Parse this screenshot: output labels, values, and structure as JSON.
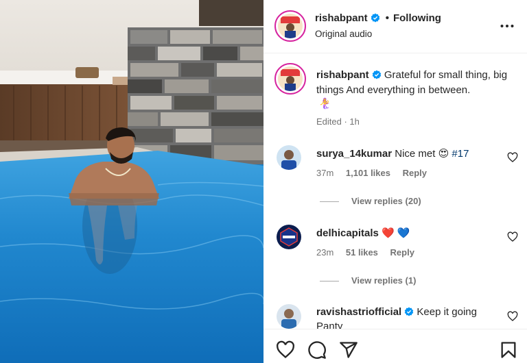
{
  "header": {
    "username": "rishabpant",
    "separator": "•",
    "follow_status": "Following",
    "subtitle": "Original audio"
  },
  "caption": {
    "username": "rishabpant",
    "text": "Grateful for small thing, big things And everything in between.",
    "emoji": "🧜‍♀️",
    "meta": "Edited · 1h"
  },
  "comments": [
    {
      "username": "surya_14kumar",
      "text": "Nice met",
      "emoji": "😍",
      "hashtag": "#17",
      "time": "37m",
      "likes": "1,101 likes",
      "reply": "Reply",
      "view_replies": "View replies (20)"
    },
    {
      "username": "delhicapitals",
      "emoji": "❤️ 💙",
      "time": "23m",
      "likes": "51 likes",
      "reply": "Reply",
      "view_replies": "View replies (1)"
    },
    {
      "username": "ravishastriofficial",
      "text": "Keep it going",
      "text_cont": "Panty"
    }
  ],
  "colors": {
    "verified": "#0095f6",
    "link": "#00376b",
    "muted": "#737373",
    "avatar_ring": "#d6249f",
    "pool_water": "#1b7fc4"
  },
  "icons": [
    "verified-badge-icon",
    "more-options-icon",
    "heart-icon",
    "comment-icon",
    "share-icon",
    "bookmark-icon"
  ]
}
